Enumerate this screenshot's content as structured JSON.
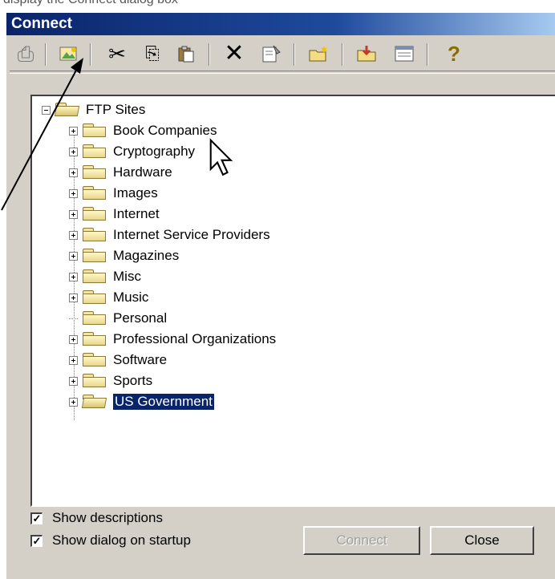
{
  "window": {
    "title": "Connect",
    "top_strip_text": "display the Connect dialog box"
  },
  "toolbar": {
    "buttons": [
      {
        "name": "connect",
        "glyph": "⎙"
      },
      {
        "name": "new-site",
        "glyph": "🖾"
      },
      {
        "name": "cut",
        "glyph": "✂"
      },
      {
        "name": "copy",
        "glyph": "⎘"
      },
      {
        "name": "paste",
        "glyph": "📋"
      },
      {
        "name": "delete",
        "glyph": "✕"
      },
      {
        "name": "properties",
        "glyph": "🗎"
      },
      {
        "name": "new-folder",
        "glyph": "📁"
      },
      {
        "name": "import",
        "glyph": "📥"
      },
      {
        "name": "view",
        "glyph": "▤"
      },
      {
        "name": "help",
        "glyph": "?"
      }
    ]
  },
  "tree": {
    "root": "FTP Sites",
    "items": [
      {
        "label": "Book Companies",
        "expandable": true
      },
      {
        "label": "Cryptography",
        "expandable": true
      },
      {
        "label": "Hardware",
        "expandable": true
      },
      {
        "label": "Images",
        "expandable": true
      },
      {
        "label": "Internet",
        "expandable": true
      },
      {
        "label": "Internet Service Providers",
        "expandable": true
      },
      {
        "label": "Magazines",
        "expandable": true
      },
      {
        "label": "Misc",
        "expandable": true
      },
      {
        "label": "Music",
        "expandable": true
      },
      {
        "label": "Personal",
        "expandable": false
      },
      {
        "label": "Professional Organizations",
        "expandable": true
      },
      {
        "label": "Software",
        "expandable": true
      },
      {
        "label": "Sports",
        "expandable": true
      },
      {
        "label": "US Government",
        "expandable": true,
        "selected": true
      }
    ]
  },
  "options": {
    "show_descriptions": {
      "label": "Show descriptions",
      "checked": true
    },
    "show_dialog_on_startup": {
      "label": "Show dialog on startup",
      "checked": true
    }
  },
  "buttons": {
    "connect": "Connect",
    "close": "Close"
  },
  "colors": {
    "selection": "#0a246a",
    "dialog_bg": "#d4d0c8",
    "title_bar": "#0a246a"
  }
}
